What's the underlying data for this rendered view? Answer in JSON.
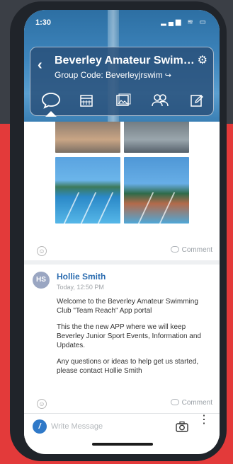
{
  "status_bar": {
    "time": "1:30",
    "indicators": "▂▄▆ ≋ ▭"
  },
  "header": {
    "back_label": "‹",
    "title": "Beverley Amateur Swimming Club",
    "group_code": "Group Code: Beverleyjrswim",
    "share_glyph": "↪",
    "gear_glyph": "⚙",
    "tabs": [
      {
        "name": "chat",
        "icon": "chat-bubble-icon",
        "active": true
      },
      {
        "name": "calendar",
        "icon": "calendar-icon",
        "active": false
      },
      {
        "name": "photos",
        "icon": "photos-icon",
        "active": false
      },
      {
        "name": "members",
        "icon": "members-icon",
        "active": false
      },
      {
        "name": "notes",
        "icon": "edit-icon",
        "active": false
      }
    ]
  },
  "posts": [
    {
      "type": "photos",
      "comment_label": "Comment",
      "emoji": "☺"
    },
    {
      "type": "text",
      "avatar_initials": "HS",
      "author": "Hollie Smith",
      "time": "Today, 12:50 PM",
      "paragraphs": [
        "Welcome to the Beverley Amateur Swimming Club \"Team Reach\" App portal",
        "This the the new APP where we will keep Beverley Junior Sport Events, Information and Updates.",
        "Any questions or ideas to help get us started, please contact Hollie Smith"
      ],
      "comment_label": "Comment",
      "emoji": "☺"
    }
  ],
  "composer": {
    "placeholder": "Write Message",
    "pen_glyph": "/",
    "more_glyph": "⋮"
  },
  "colors": {
    "accent": "#2f79c8",
    "author": "#2b6cb0",
    "header": "#284e78",
    "background": "#e33a3a"
  }
}
